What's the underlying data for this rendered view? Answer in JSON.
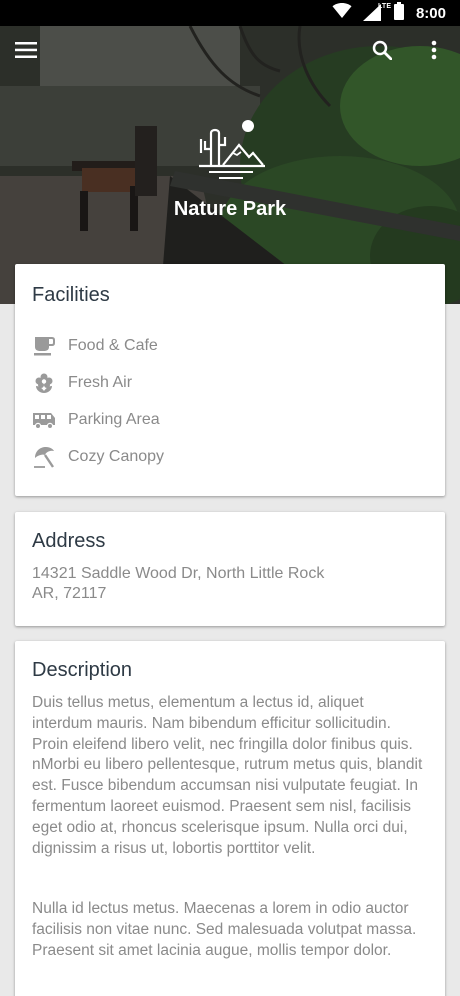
{
  "status_bar": {
    "time": "8:00",
    "network_label": "LTE",
    "icons": [
      "wifi-icon",
      "cell-signal-icon",
      "battery-icon"
    ]
  },
  "app_bar": {
    "menu_icon": "hamburger-menu-icon",
    "search_icon": "search-icon",
    "more_icon": "more-vertical-icon"
  },
  "hero": {
    "logo_icon": "nature-park-logo-icon",
    "title": "Nature Park"
  },
  "facilities": {
    "title": "Facilities",
    "items": [
      {
        "label": "Food & Cafe",
        "icon": "coffee-cup-icon"
      },
      {
        "label": "Fresh Air",
        "icon": "flower-icon"
      },
      {
        "label": "Parking Area",
        "icon": "bus-icon"
      },
      {
        "label": "Cozy Canopy",
        "icon": "beach-umbrella-icon"
      }
    ]
  },
  "address": {
    "title": "Address",
    "lines": [
      "14321 Saddle Wood Dr, North Little Rock",
      "AR, 72117"
    ]
  },
  "description": {
    "title": "Description",
    "paragraphs": [
      "Duis tellus metus, elementum a lectus id, aliquet interdum mauris. Nam bibendum efficitur sollicitudin. Proin eleifend libero velit, nec fringilla dolor finibus quis. nMorbi eu libero pellentesque, rutrum metus quis, blandit est. Fusce bibendum accumsan nisi vulputate feugiat. In fermentum laoreet euismod. Praesent sem nisl, facilisis eget odio at, rhoncus scelerisque ipsum. Nulla orci dui, dignissim a risus ut, lobortis porttitor velit.",
      "Nulla id lectus metus. Maecenas a lorem in odio auctor facilisis non vitae nunc. Sed malesuada volutpat massa. Praesent sit amet lacinia augue, mollis tempor dolor."
    ]
  },
  "colors": {
    "title_text": "#2e3a45",
    "body_text": "#8a8a8a",
    "icon": "#9a9a9a",
    "background": "#e9e9e9",
    "status_bar": "#000000"
  }
}
